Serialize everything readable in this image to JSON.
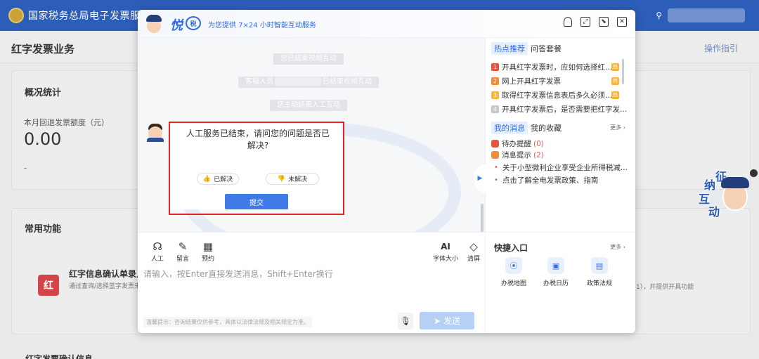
{
  "site": {
    "title": "国家税务总局电子发票服务"
  },
  "page": {
    "title": "红字发票业务",
    "guide_link": "操作指引"
  },
  "stats": {
    "section_title": "概况统计",
    "label": "本月回退发票额度（元）",
    "value": "0.00",
    "dash": "-"
  },
  "functions": {
    "section_title": "常用功能",
    "item_title": "红字信息确认单录入",
    "item_desc": "通过查询/选择蓝字发票来",
    "right_desc": "1），并提供开具功能",
    "icon_text": "红"
  },
  "bottom_section": {
    "title": "红字发票确认信息"
  },
  "mascot": {
    "chars": [
      "征",
      "纳",
      "互",
      "动"
    ]
  },
  "modal": {
    "brand": "悦",
    "badge": "税",
    "tagline": "为您提供 7×24 小时智能互动服务",
    "tools": [
      {
        "name": "person-icon",
        "glyph": ""
      },
      {
        "name": "expand-icon",
        "glyph": "⤢"
      },
      {
        "name": "minimize-icon",
        "glyph": "⬊"
      },
      {
        "name": "close-icon",
        "glyph": "✕"
      }
    ],
    "chat": {
      "system_messages": [
        "您已结束视频互动",
        "客服人员",
        "已结束视频互动",
        "您主动结束人工互动"
      ],
      "bubble_text": "人工服务已结束，请问您的问题是否已解决?",
      "resolved_label": "已解决",
      "unresolved_label": "未解决",
      "submit_label": "提交"
    },
    "input": {
      "tools": [
        {
          "name": "agent",
          "label": "人工",
          "glyph": "☊"
        },
        {
          "name": "message",
          "label": "留言",
          "glyph": "✎"
        },
        {
          "name": "appointment",
          "label": "预约",
          "glyph": "▦"
        }
      ],
      "font_size_label": "字体大小",
      "font_size_glyph": "AI",
      "clear_label": "清屏",
      "clear_glyph": "◇",
      "placeholder": "请输入，按Enter直接发送消息，Shift+Enter换行",
      "tip": "温馨提示：咨询结果仅供参考，具体以法律法规及相关规定为准。",
      "send_label": "发送"
    },
    "right": {
      "tabs": {
        "hot": "热点推荐",
        "faq": "问答套餐"
      },
      "hot_items": [
        {
          "num": "1",
          "text": "开具红字发票时，应如何选择红...",
          "tag": "热",
          "color": "#e8523f"
        },
        {
          "num": "2",
          "text": "网上开具红字发票",
          "tag": "热",
          "color": "#f08c3a"
        },
        {
          "num": "3",
          "text": "取得红字发票信息表后多久必须...",
          "tag": "热",
          "color": "#f5b53d"
        },
        {
          "num": "4",
          "text": "开具红字发票后，是否需要把红字发...",
          "tag": "",
          "color": "#c4c8d0"
        }
      ],
      "msg_tabs": {
        "my_messages": "我的消息",
        "favorites": "我的收藏"
      },
      "more_label": "更多 ›",
      "todo_label": "待办提醒",
      "todo_count": "(0)",
      "notice_label": "消息提示",
      "notice_count": "(2)",
      "notices": [
        "关于小型微利企业享受企业所得税减...",
        "点击了解全电发票政策、指南"
      ],
      "quick_title": "快捷入口",
      "quick_more": "更多 ›",
      "quick_items": [
        {
          "label": "办税地图",
          "icon": "⦿"
        },
        {
          "label": "办税日历",
          "icon": "▣"
        },
        {
          "label": "政策法规",
          "icon": "▤"
        }
      ]
    }
  },
  "colors": {
    "accent": "#2f6be6",
    "highlight_box": "#e02424",
    "header_bar": "#2c5db8"
  }
}
